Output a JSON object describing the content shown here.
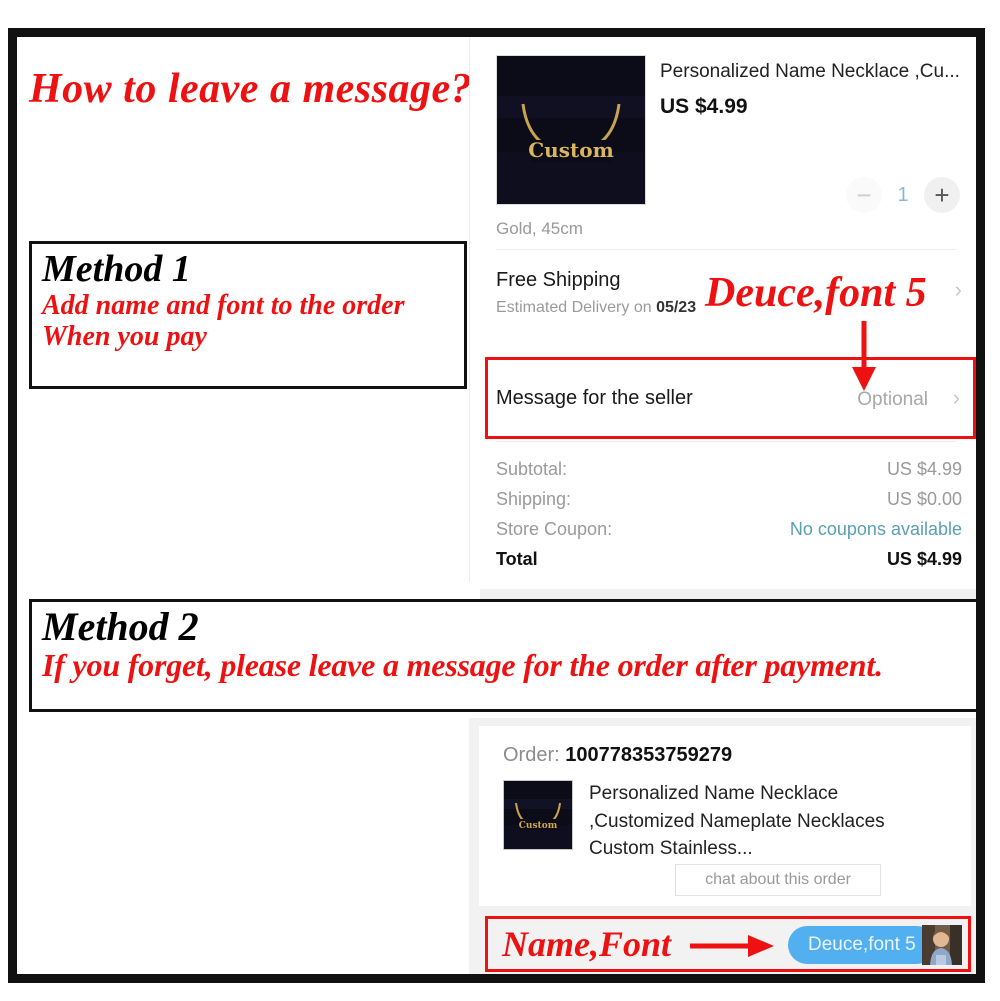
{
  "headline": "How to leave a message?",
  "method1": {
    "title": "Method 1",
    "line1": "Add name and font to the order",
    "line2": "When you pay"
  },
  "method2": {
    "title": "Method 2",
    "line1": "If you forget, please leave a message for the order after payment."
  },
  "annotations": {
    "deuce_font": "Deuce,font 5",
    "name_font": "Name,Font"
  },
  "checkout": {
    "product_title": "Personalized Name Necklace ,Cu...",
    "product_price": "US $4.99",
    "variant": "Gold, 45cm",
    "thumb_text": "Custom",
    "stepper": {
      "minus_label": "−",
      "quantity": "1",
      "plus_label": "+"
    },
    "shipping": {
      "title": "Free Shipping",
      "estimate_prefix": "Estimated Delivery on ",
      "estimate_date": "05/23",
      "chevron": "›"
    },
    "message": {
      "label": "Message for the seller",
      "value": "Optional",
      "chevron": "›"
    },
    "totals": [
      {
        "label": "Subtotal:",
        "value": "US $4.99"
      },
      {
        "label": "Shipping:",
        "value": "US $0.00"
      },
      {
        "label": "Store Coupon:",
        "value": "No coupons available"
      },
      {
        "label": "Total",
        "value": "US $4.99"
      }
    ]
  },
  "order": {
    "order_prefix": "Order: ",
    "order_number": "100778353759279",
    "description": "Personalized Name Necklace ,Customized Nameplate Necklaces Custom Stainless...",
    "chat_button": "chat about this order",
    "thumb_text": "Custom"
  },
  "chat": {
    "bubble_text": "Deuce,font 5"
  },
  "colors": {
    "annotation_red": "#ee1111",
    "frame_black": "#111111",
    "bubble_blue": "#53b0f0",
    "coupon_link": "#5a9fb5",
    "qty_blue": "#8cb6d6"
  }
}
